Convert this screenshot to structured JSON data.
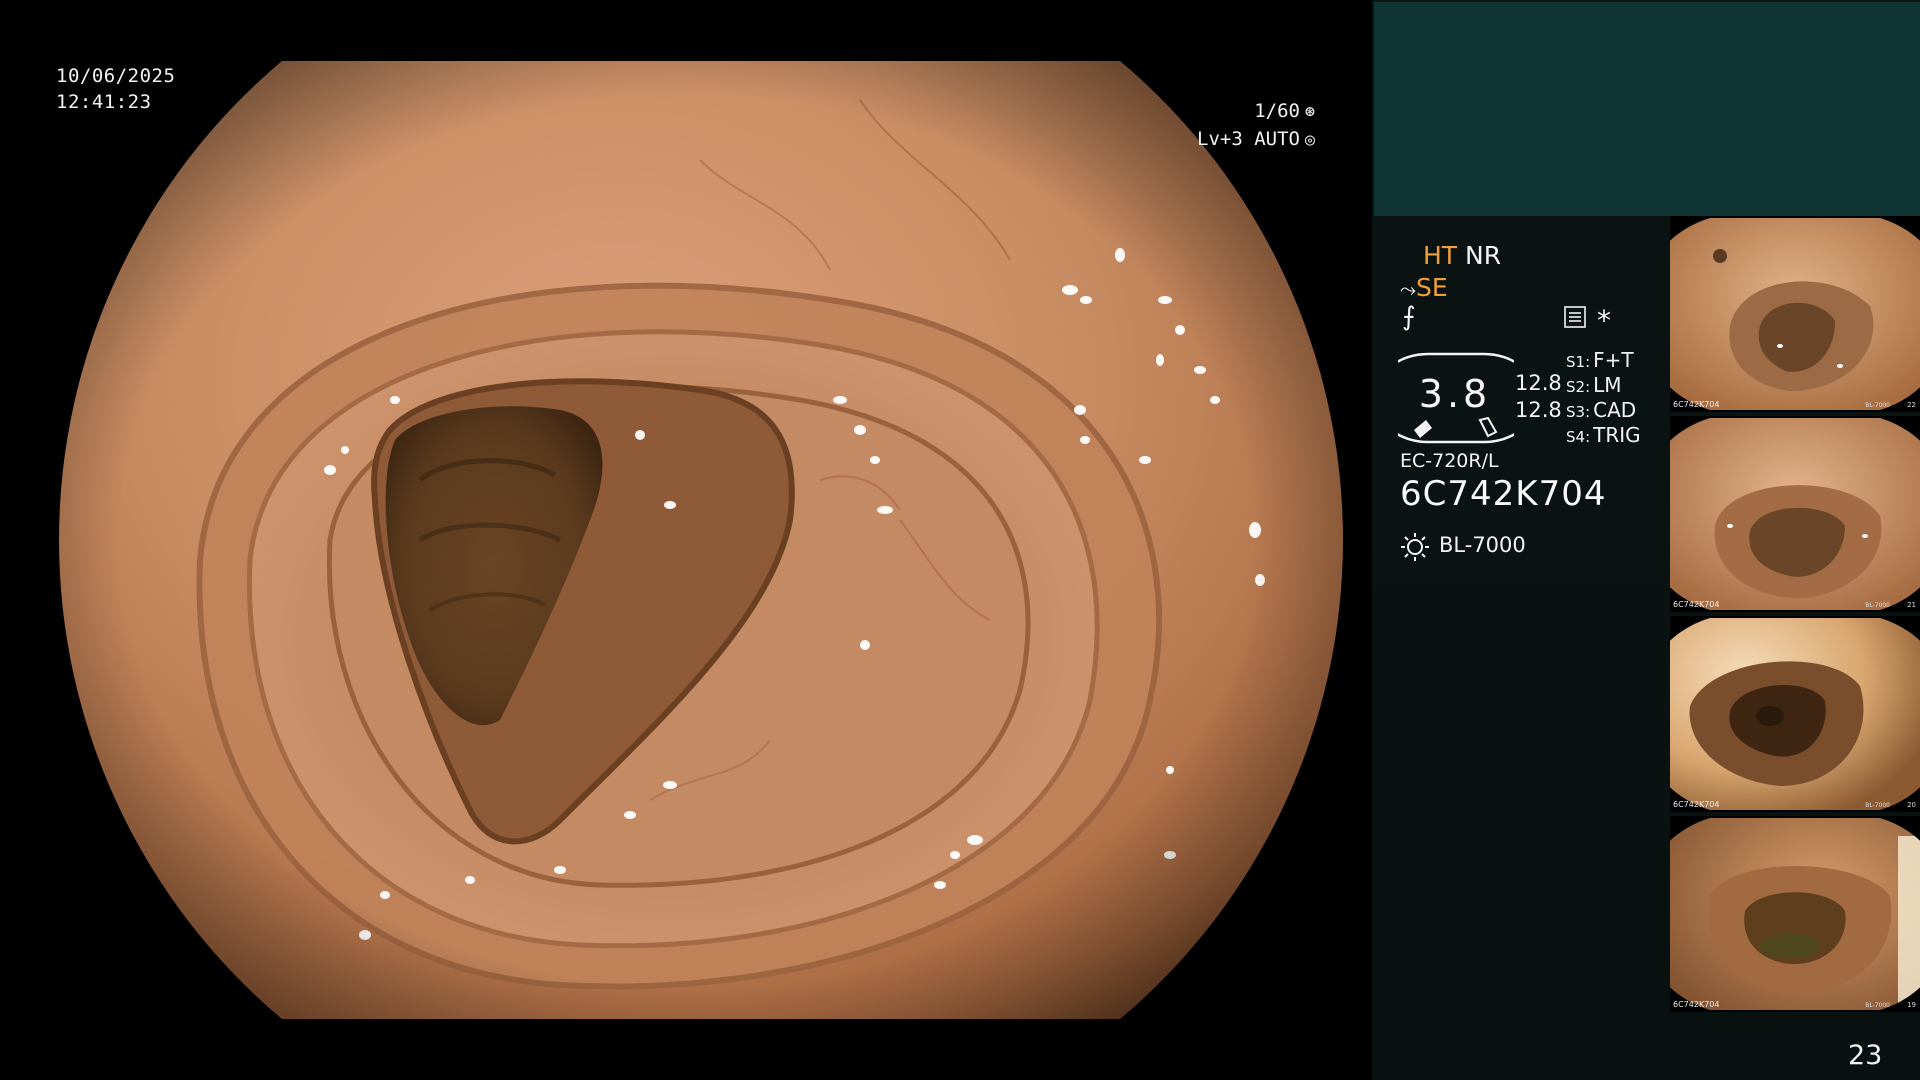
{
  "overlay": {
    "date": "10/06/2025",
    "time": "12:41:23",
    "shutter": "1/60",
    "shutter_icon": "aperture-icon",
    "iris": "Lv+3 AUTO",
    "iris_icon": "iris-icon"
  },
  "status": {
    "ht": "HT",
    "nr": "NR",
    "se": "SE",
    "se_icon": "curve-icon",
    "scope_icon": "slash-f-icon",
    "menu_icon": "list-menu-icon",
    "star": "*"
  },
  "gauge": {
    "value": "3.8",
    "readout_1": "12.8",
    "readout_2": "12.8"
  },
  "switches": [
    {
      "key": "S1:",
      "value": "F+T"
    },
    {
      "key": "S2:",
      "value": "LM"
    },
    {
      "key": "S3:",
      "value": "CAD"
    },
    {
      "key": "S4:",
      "value": "TRIG"
    }
  ],
  "scope": {
    "model": "EC-720R/L",
    "serial": "6C742K704",
    "light_source": "BL-7000",
    "light_icon": "sun-icon"
  },
  "thumbnails": [
    {
      "serial": "6C742K704",
      "light": "BL-7000",
      "number": "22"
    },
    {
      "serial": "6C742K704",
      "light": "BL-7000",
      "number": "21"
    },
    {
      "serial": "6C742K704",
      "light": "BL-7000",
      "number": "20"
    },
    {
      "serial": "6C742K704",
      "light": "BL-7000",
      "number": "19"
    }
  ],
  "page_number": "23",
  "colors": {
    "mucosa": "#c88c62",
    "mucosa_dark": "#7a4a2a",
    "lumen": "#4e3018",
    "panel_top": "#103334",
    "label_accent": "#f0a03a"
  }
}
